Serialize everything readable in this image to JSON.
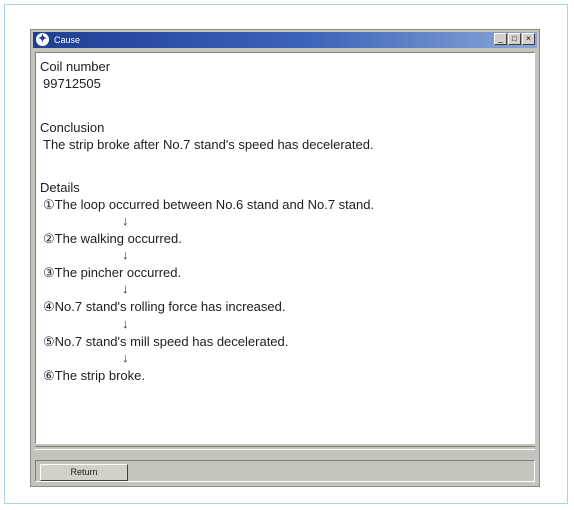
{
  "window": {
    "title": "Cause",
    "minimize_glyph": "_",
    "maximize_glyph": "□",
    "close_glyph": "×"
  },
  "coil": {
    "label": "Coil  number",
    "value": "99712505"
  },
  "conclusion": {
    "label": "Conclusion",
    "text": "The strip broke after No.7 stand's speed has decelerated."
  },
  "details": {
    "label": "Details",
    "arrow": "↓",
    "steps": [
      "①The loop occurred between No.6 stand and No.7 stand.",
      "②The walking occurred.",
      "③The pincher occurred.",
      "④No.7 stand's rolling force has increased.",
      "⑤No.7 stand's mill speed has decelerated.",
      "⑥The strip broke."
    ]
  },
  "footer": {
    "return_label": "Return"
  }
}
